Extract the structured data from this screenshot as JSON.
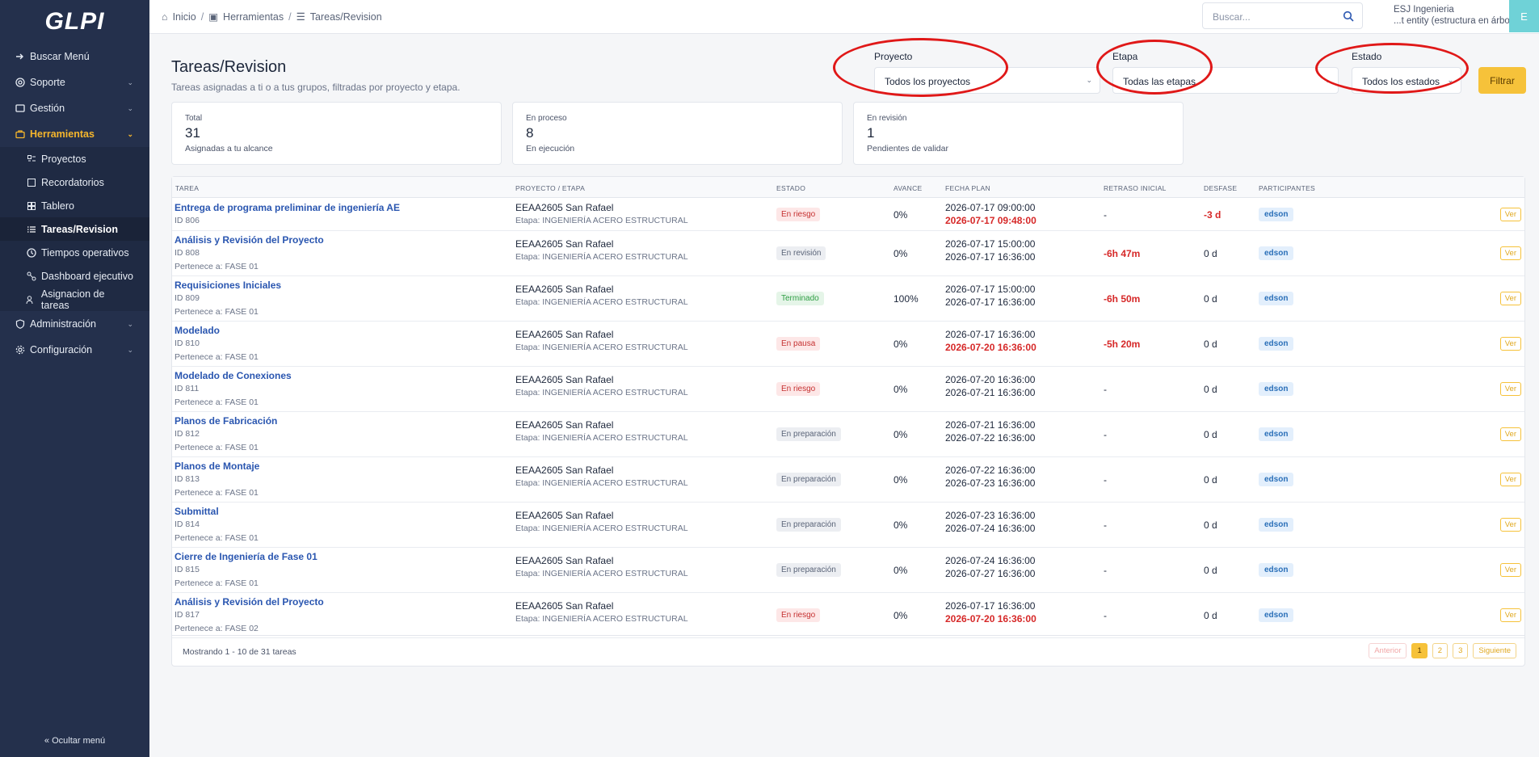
{
  "app": {
    "logo": "GLPI"
  },
  "sidebar": {
    "items": [
      {
        "label": "Buscar Menú",
        "icon": "arrow-right-icon"
      },
      {
        "label": "Soporte",
        "icon": "lifebuoy-icon"
      },
      {
        "label": "Gestión",
        "icon": "wallet-icon"
      },
      {
        "label": "Herramientas",
        "icon": "briefcase-icon"
      },
      {
        "label": "Administración",
        "icon": "shield-icon"
      },
      {
        "label": "Configuración",
        "icon": "gear-icon"
      }
    ],
    "subitems": [
      {
        "label": "Proyectos"
      },
      {
        "label": "Recordatorios"
      },
      {
        "label": "Tablero"
      },
      {
        "label": "Tareas/Revision"
      },
      {
        "label": "Tiempos operativos"
      },
      {
        "label": "Dashboard ejecutivo"
      },
      {
        "label": "Asignacion de tareas"
      }
    ],
    "hide_menu": "Ocultar menú"
  },
  "breadcrumb": {
    "home": "Inicio",
    "tools": "Herramientas",
    "current": "Tareas/Revision"
  },
  "search": {
    "placeholder": "Buscar..."
  },
  "user": {
    "entity": "ESJ Ingenieria",
    "scope": "...t entity (estructura en árbol)",
    "avatar": "E"
  },
  "page": {
    "title": "Tareas/Revision",
    "subtitle": "Tareas asignadas a ti o a tus grupos, filtradas por proyecto y etapa."
  },
  "filters": {
    "proyecto": {
      "label": "Proyecto",
      "value": "Todos los proyectos"
    },
    "etapa": {
      "label": "Etapa",
      "value": "Todas las etapas"
    },
    "estado": {
      "label": "Estado",
      "value": "Todos los estados"
    },
    "button": "Filtrar"
  },
  "stats": [
    {
      "label": "Total",
      "value": "31",
      "desc": "Asignadas a tu alcance"
    },
    {
      "label": "En proceso",
      "value": "8",
      "desc": "En ejecución"
    },
    {
      "label": "En revisión",
      "value": "1",
      "desc": "Pendientes de validar"
    }
  ],
  "table": {
    "headers": [
      "Tarea",
      "Proyecto / Etapa",
      "Estado",
      "Avance",
      "Fecha plan",
      "Retraso inicial",
      "Desfase",
      "Participantes"
    ],
    "rows": [
      {
        "name": "Entrega de programa preliminar de ingeniería AE",
        "id": "ID 806",
        "belongs": "",
        "project": "EEAA2605 San Rafael",
        "stage": "Etapa: INGENIERÍA ACERO ESTRUCTURAL",
        "status": "En riesgo",
        "status_class": "b-riesgo",
        "progress": "0%",
        "date1": "2026-07-17 09:00:00",
        "date2": "2026-07-17 09:48:00",
        "date2_red": true,
        "delay": "-",
        "delay_red": false,
        "offset": "-3 d",
        "offset_red": true,
        "participant": "edson",
        "action": "Ver"
      },
      {
        "name": "Análisis y Revisión del Proyecto",
        "id": "ID 808",
        "belongs": "Pertenece a: FASE 01",
        "project": "EEAA2605 San Rafael",
        "stage": "Etapa: INGENIERÍA ACERO ESTRUCTURAL",
        "status": "En revisión",
        "status_class": "b-revision",
        "progress": "0%",
        "date1": "2026-07-17 15:00:00",
        "date2": "2026-07-17 16:36:00",
        "date2_red": false,
        "delay": "-6h 47m",
        "delay_red": true,
        "offset": "0 d",
        "offset_red": false,
        "participant": "edson",
        "action": "Ver"
      },
      {
        "name": "Requisiciones Iniciales",
        "id": "ID 809",
        "belongs": "Pertenece a: FASE 01",
        "project": "EEAA2605 San Rafael",
        "stage": "Etapa: INGENIERÍA ACERO ESTRUCTURAL",
        "status": "Terminado",
        "status_class": "b-terminado",
        "progress": "100%",
        "date1": "2026-07-17 15:00:00",
        "date2": "2026-07-17 16:36:00",
        "date2_red": false,
        "delay": "-6h 50m",
        "delay_red": true,
        "offset": "0 d",
        "offset_red": false,
        "participant": "edson",
        "action": "Ver"
      },
      {
        "name": "Modelado",
        "id": "ID 810",
        "belongs": "Pertenece a: FASE 01",
        "project": "EEAA2605 San Rafael",
        "stage": "Etapa: INGENIERÍA ACERO ESTRUCTURAL",
        "status": "En pausa",
        "status_class": "b-pausa",
        "progress": "0%",
        "date1": "2026-07-17 16:36:00",
        "date2": "2026-07-20 16:36:00",
        "date2_red": true,
        "delay": "-5h 20m",
        "delay_red": true,
        "offset": "0 d",
        "offset_red": false,
        "participant": "edson",
        "action": "Ver"
      },
      {
        "name": "Modelado de Conexiones",
        "id": "ID 811",
        "belongs": "Pertenece a: FASE 01",
        "project": "EEAA2605 San Rafael",
        "stage": "Etapa: INGENIERÍA ACERO ESTRUCTURAL",
        "status": "En riesgo",
        "status_class": "b-riesgo",
        "progress": "0%",
        "date1": "2026-07-20 16:36:00",
        "date2": "2026-07-21 16:36:00",
        "date2_red": false,
        "delay": "-",
        "delay_red": false,
        "offset": "0 d",
        "offset_red": false,
        "participant": "edson",
        "action": "Ver"
      },
      {
        "name": "Planos de Fabricación",
        "id": "ID 812",
        "belongs": "Pertenece a: FASE 01",
        "project": "EEAA2605 San Rafael",
        "stage": "Etapa: INGENIERÍA ACERO ESTRUCTURAL",
        "status": "En preparación",
        "status_class": "b-prep",
        "progress": "0%",
        "date1": "2026-07-21 16:36:00",
        "date2": "2026-07-22 16:36:00",
        "date2_red": false,
        "delay": "-",
        "delay_red": false,
        "offset": "0 d",
        "offset_red": false,
        "participant": "edson",
        "action": "Ver"
      },
      {
        "name": "Planos de Montaje",
        "id": "ID 813",
        "belongs": "Pertenece a: FASE 01",
        "project": "EEAA2605 San Rafael",
        "stage": "Etapa: INGENIERÍA ACERO ESTRUCTURAL",
        "status": "En preparación",
        "status_class": "b-prep",
        "progress": "0%",
        "date1": "2026-07-22 16:36:00",
        "date2": "2026-07-23 16:36:00",
        "date2_red": false,
        "delay": "-",
        "delay_red": false,
        "offset": "0 d",
        "offset_red": false,
        "participant": "edson",
        "action": "Ver"
      },
      {
        "name": "Submittal",
        "id": "ID 814",
        "belongs": "Pertenece a: FASE 01",
        "project": "EEAA2605 San Rafael",
        "stage": "Etapa: INGENIERÍA ACERO ESTRUCTURAL",
        "status": "En preparación",
        "status_class": "b-prep",
        "progress": "0%",
        "date1": "2026-07-23 16:36:00",
        "date2": "2026-07-24 16:36:00",
        "date2_red": false,
        "delay": "-",
        "delay_red": false,
        "offset": "0 d",
        "offset_red": false,
        "participant": "edson",
        "action": "Ver"
      },
      {
        "name": "Cierre de Ingeniería de Fase 01",
        "id": "ID 815",
        "belongs": "Pertenece a: FASE 01",
        "project": "EEAA2605 San Rafael",
        "stage": "Etapa: INGENIERÍA ACERO ESTRUCTURAL",
        "status": "En preparación",
        "status_class": "b-prep",
        "progress": "0%",
        "date1": "2026-07-24 16:36:00",
        "date2": "2026-07-27 16:36:00",
        "date2_red": false,
        "delay": "-",
        "delay_red": false,
        "offset": "0 d",
        "offset_red": false,
        "participant": "edson",
        "action": "Ver"
      },
      {
        "name": "Análisis y Revisión del Proyecto",
        "id": "ID 817",
        "belongs": "Pertenece a: FASE 02",
        "project": "EEAA2605 San Rafael",
        "stage": "Etapa: INGENIERÍA ACERO ESTRUCTURAL",
        "status": "En riesgo",
        "status_class": "b-riesgo",
        "progress": "0%",
        "date1": "2026-07-17 16:36:00",
        "date2": "2026-07-20 16:36:00",
        "date2_red": true,
        "delay": "-",
        "delay_red": false,
        "offset": "0 d",
        "offset_red": false,
        "participant": "edson",
        "action": "Ver"
      }
    ]
  },
  "pagination": {
    "showing": "Mostrando 1 - 10 de 31 tareas",
    "prev": "Anterior",
    "pages": [
      "1",
      "2",
      "3"
    ],
    "next": "Siguiente"
  }
}
